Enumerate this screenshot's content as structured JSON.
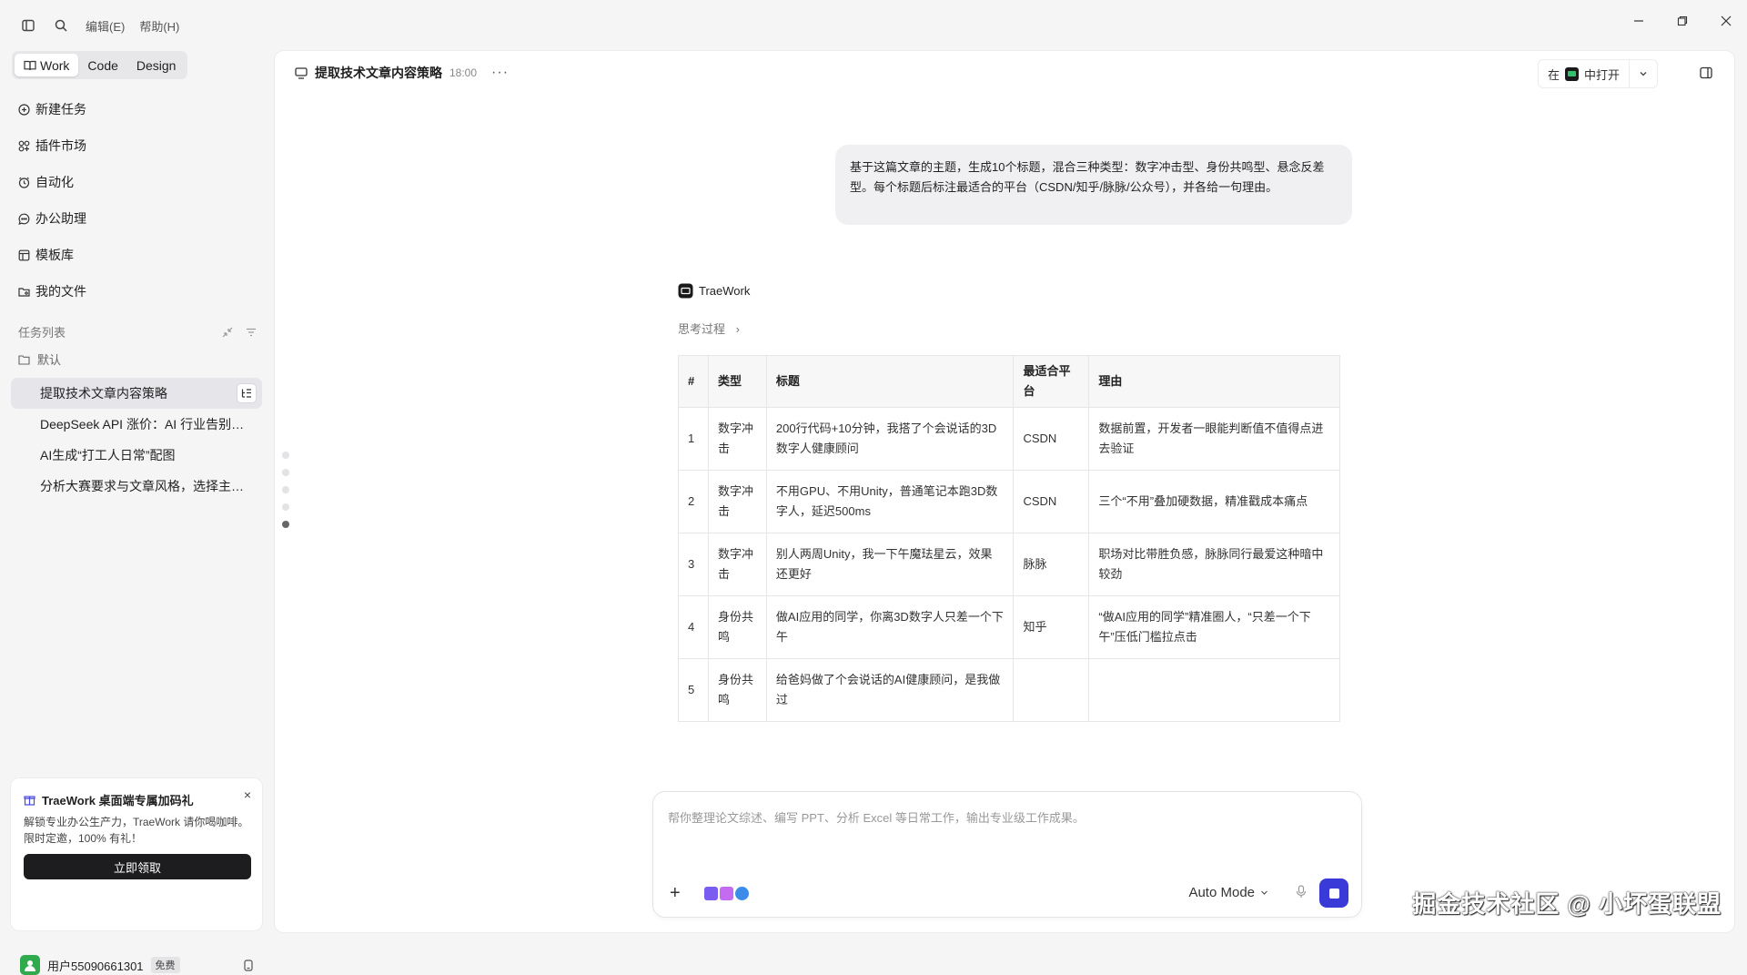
{
  "topbar": {
    "menus": [
      "编辑(E)",
      "帮助(H)"
    ]
  },
  "sidebar": {
    "modes": [
      "Work",
      "Code",
      "Design"
    ],
    "nav": [
      "新建任务",
      "插件市场",
      "自动化",
      "办公助理",
      "模板库",
      "我的文件"
    ],
    "section_title": "任务列表",
    "folder": "默认",
    "tasks": [
      "提取技术文章内容策略",
      "DeepSeek API 涨价：AI 行业告别白菜价时代",
      "AI生成“打工人日常”配图",
      "分析大赛要求与文章风格，选择主题与平台"
    ],
    "promo": {
      "title": "TraeWork 桌面端专属加码礼",
      "desc": "解锁专业办公生产力，TraeWork 请你喝咖啡。限时定邀，100% 有礼！",
      "button": "立即领取"
    },
    "user": {
      "name": "用户55090661301",
      "badge": "免费"
    }
  },
  "header": {
    "title": "提取技术文章内容策略",
    "time": "18:00",
    "more": "···",
    "open_prefix": "在",
    "open_suffix": "中打开"
  },
  "conversation": {
    "user_message": "基于这篇文章的主题，生成10个标题，混合三种类型：数字冲击型、身份共鸣型、悬念反差型。每个标题后标注最适合的平台（CSDN/知乎/脉脉/公众号），并各给一句理由。",
    "assistant_name": "TraeWork",
    "thinking_label": "思考过程",
    "table": {
      "headers": [
        "#",
        "类型",
        "标题",
        "最适合平台",
        "理由"
      ],
      "rows": [
        [
          "1",
          "数字冲击",
          "200行代码+10分钟，我搭了个会说话的3D数字人健康顾问",
          "CSDN",
          "数据前置，开发者一眼能判断值不值得点进去验证"
        ],
        [
          "2",
          "数字冲击",
          "不用GPU、不用Unity，普通笔记本跑3D数字人，延迟500ms",
          "CSDN",
          "三个“不用”叠加硬数据，精准戳成本痛点"
        ],
        [
          "3",
          "数字冲击",
          "别人两周Unity，我一下午魔珐星云，效果还更好",
          "脉脉",
          "职场对比带胜负感，脉脉同行最爱这种暗中较劲"
        ],
        [
          "4",
          "身份共鸣",
          "做AI应用的同学，你离3D数字人只差一个下午",
          "知乎",
          "“做AI应用的同学”精准圈人，“只差一个下午”压低门槛拉点击"
        ],
        [
          "5",
          "身份共鸣",
          "给爸妈做了个会说话的AI健康顾问，是我做过",
          "",
          ""
        ]
      ]
    }
  },
  "composer": {
    "placeholder": "帮你整理论文综述、编写 PPT、分析 Excel 等日常工作，输出专业级工作成果。",
    "mode": "Auto Mode"
  },
  "watermark": "掘金技术社区 @ 小坏蛋联盟",
  "colors": {
    "accent": "#3a3ad8",
    "avatar": "#2faa4d"
  }
}
